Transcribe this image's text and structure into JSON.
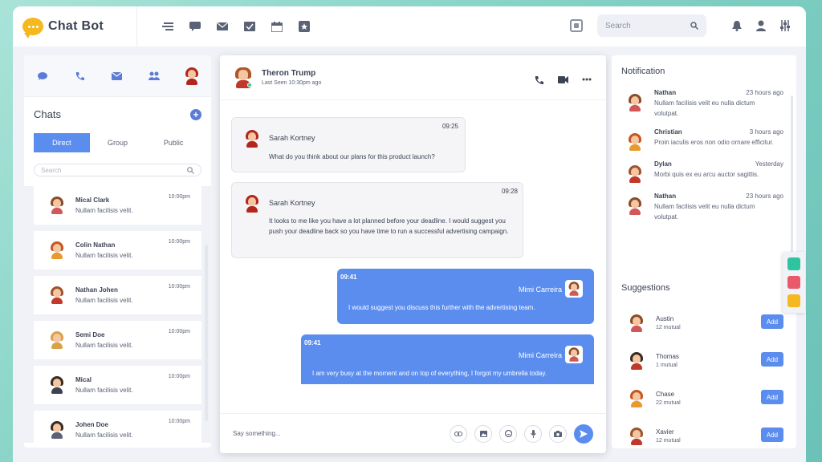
{
  "app": {
    "title": "Chat Bot"
  },
  "topbar": {
    "nav_icons": [
      "menu-icon",
      "chat-icon",
      "mail-icon",
      "tasks-icon",
      "calendar-icon",
      "star-icon"
    ],
    "search_placeholder": "Search"
  },
  "left": {
    "title": "Chats",
    "tabs": [
      "Direct",
      "Group",
      "Public"
    ],
    "active_tab": "Direct",
    "search_placeholder": "Search",
    "chats": [
      {
        "name": "Mical Clark",
        "msg": "Nullam facilisis velit.",
        "time": "10:00pm"
      },
      {
        "name": "Colin Nathan",
        "msg": "Nullam facilisis velit.",
        "time": "10:00pm"
      },
      {
        "name": "Nathan Johen",
        "msg": "Nullam facilisis velit.",
        "time": "10:00pm"
      },
      {
        "name": "Semi Doe",
        "msg": "Nullam facilisis velit.",
        "time": "10:00pm"
      },
      {
        "name": "Mical",
        "msg": "Nullam facilisis velit.",
        "time": "10:00pm"
      },
      {
        "name": "Johen Doe",
        "msg": "Nullam facilisis velit.",
        "time": "10:00pm"
      }
    ]
  },
  "chat": {
    "contact_name": "Theron Trump",
    "status": "Last Seen 10:30pm ago",
    "messages": [
      {
        "dir": "in",
        "sender": "Sarah Kortney",
        "time": "09:25",
        "text": "What do you think about our plans for this product launch?"
      },
      {
        "dir": "in",
        "sender": "Sarah Kortney",
        "time": "09:28",
        "text": "It looks to me like you have a lot planned before your deadline. I would suggest you push your deadline back so you have time to run a successful advertising campaign."
      },
      {
        "dir": "out",
        "sender": "Mimi Carreira",
        "time": "09:41",
        "text": "I would suggest you discuss this further with the advertising team."
      },
      {
        "dir": "out",
        "sender": "Mimi Carreira",
        "time": "09:41",
        "text": "I am very busy at the moment and on top of everything, I forgot my umbrella today."
      }
    ],
    "input_placeholder": "Say something..."
  },
  "notifications": {
    "title": "Notification",
    "items": [
      {
        "name": "Nathan",
        "time": "23 hours ago",
        "text": "Nullam facilisis velit eu nulla dictum volutpat."
      },
      {
        "name": "Christian",
        "time": "3 hours ago",
        "text": "Proin iaculis eros non odio ornare efficitur."
      },
      {
        "name": "Dylan",
        "time": "Yesterday",
        "text": "Morbi quis ex eu arcu auctor sagittis."
      },
      {
        "name": "Nathan",
        "time": "23 hours ago",
        "text": "Nullam facilisis velit eu nulla dictum volutpat."
      }
    ]
  },
  "suggestions": {
    "title": "Suggestions",
    "add_label": "Add",
    "items": [
      {
        "name": "Austin",
        "mutual": "12 mutual"
      },
      {
        "name": "Thomas",
        "mutual": "1 mutual"
      },
      {
        "name": "Chase",
        "mutual": "22 mutual"
      },
      {
        "name": "Xavier",
        "mutual": "12 mutual"
      }
    ]
  },
  "colors": {
    "accent": "#5b8def",
    "logo": "#f5b81f",
    "online": "#3ec98f"
  }
}
